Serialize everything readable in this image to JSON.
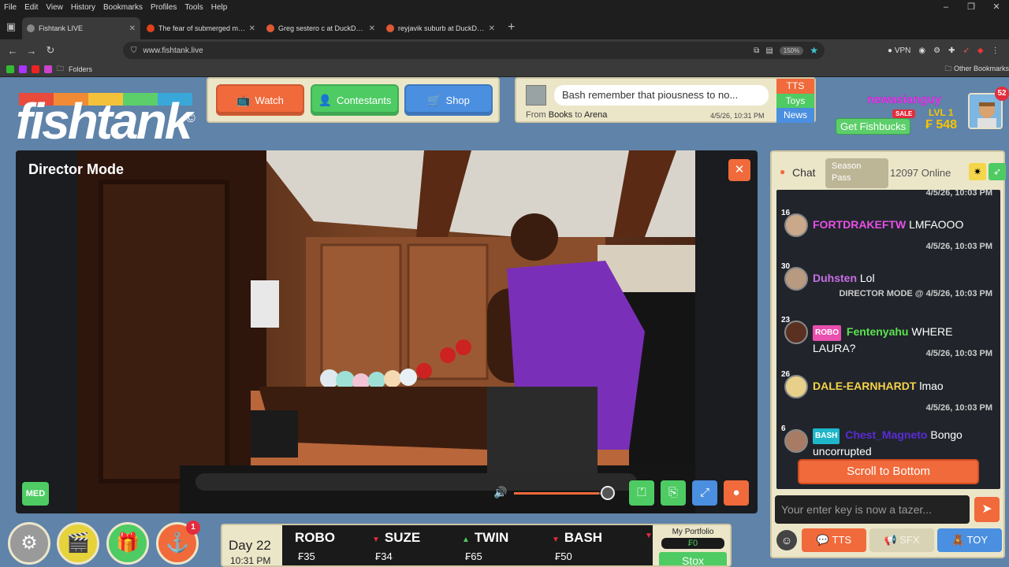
{
  "menu": [
    "File",
    "Edit",
    "View",
    "History",
    "Bookmarks",
    "Profiles",
    "Tools",
    "Help"
  ],
  "window_controls": [
    "–",
    "❐",
    "✕"
  ],
  "tabs": [
    {
      "title": "Fishtank LIVE",
      "color": "#888888",
      "active": true
    },
    {
      "title": "The fear of submerged machin...",
      "color": "#e0401a",
      "active": false
    },
    {
      "title": "Greg sestero c at DuckDuckGo",
      "color": "#de5833",
      "active": false
    },
    {
      "title": "reyjavik suburb at DuckDuckGo",
      "color": "#de5833",
      "active": false
    }
  ],
  "url": "www.fishtank.live",
  "zoom": "150%",
  "vpn_label": "VPN",
  "bookmarks_folder": "Folders",
  "other_bookmarks": "Other Bookmarks",
  "logo": {
    "word": "fishtank",
    "reg": "©"
  },
  "nav": {
    "watch": "Watch",
    "contestants": "Contestants",
    "shop": "Shop"
  },
  "tts_panel": {
    "message": "Bash remember that piousness to no...",
    "from_label": "From",
    "from": "Books",
    "to_label": "to",
    "to": "Arena",
    "time": "4/5/26, 10:31 PM",
    "tabs": [
      "TTS",
      "Toys",
      "News"
    ]
  },
  "user": {
    "name": "newasianguy",
    "sale": "SALE",
    "level": "LVL 1",
    "get_fishbucks": "Get Fishbucks",
    "balance": "₣ 548",
    "notifications": "52"
  },
  "player": {
    "mode": "Director Mode",
    "quality": "MED",
    "volume": 0.9
  },
  "chat": {
    "title": "Chat",
    "season_pass": "Season Pass",
    "online": "12097 Online",
    "partial_timestamp": "4/5/26, 10:03 PM",
    "messages": [
      {
        "level": "16",
        "name": "FORTDRAKEFTW",
        "name_color": "#e84fe8",
        "text": "LMFAOOO",
        "badge": "",
        "time": "4/5/26, 10:03 PM",
        "prefix": ""
      },
      {
        "level": "30",
        "name": "Duhsten",
        "name_color": "#c96ee6",
        "text": "Lol",
        "badge": "",
        "time": "4/5/26, 10:03 PM",
        "prefix": "DIRECTOR MODE @"
      },
      {
        "level": "23",
        "name": "Fentenyahu",
        "name_color": "#5be34f",
        "text": "WHERE LAURA?",
        "badge": "ROBO",
        "badge_color": "#e84fae",
        "time": "4/5/26, 10:03 PM",
        "prefix": ""
      },
      {
        "level": "26",
        "name": "DALE-EARNHARDT",
        "name_color": "#f5d24a",
        "text": "lmao",
        "badge": "",
        "time": "4/5/26, 10:03 PM",
        "prefix": ""
      },
      {
        "level": "6",
        "name": "Chest_Magneto",
        "name_color": "#5a2bd6",
        "text": "Bongo uncorrupted",
        "badge": "BASH",
        "badge_color": "#1fb6c9",
        "time": "",
        "prefix": ""
      }
    ],
    "scroll_to_bottom": "Scroll to Bottom",
    "input_placeholder": "Your enter key is now a tazer...",
    "buttons": {
      "tts": "TTS",
      "sfx": "SFX",
      "toy": "TOY"
    }
  },
  "bottom": {
    "alert_badge": "1",
    "day": "Day 22",
    "clock": "10:31 PM",
    "stocks": [
      {
        "symbol": "ROBO",
        "price": "₣35",
        "trend": "none"
      },
      {
        "symbol": "SUZE",
        "price": "₣34",
        "trend": "down"
      },
      {
        "symbol": "TWIN",
        "price": "₣65",
        "trend": "up"
      },
      {
        "symbol": "BASH",
        "price": "₣50",
        "trend": "down"
      }
    ],
    "portfolio_label": "My Portfolio",
    "portfolio_value": "₣0",
    "stox": "Stox"
  },
  "colors": {
    "page_bg": "#5f83a9",
    "orange": "#f16a3b",
    "green": "#4ecb63",
    "blue": "#4a8fe0",
    "cream": "#ece6c9"
  }
}
